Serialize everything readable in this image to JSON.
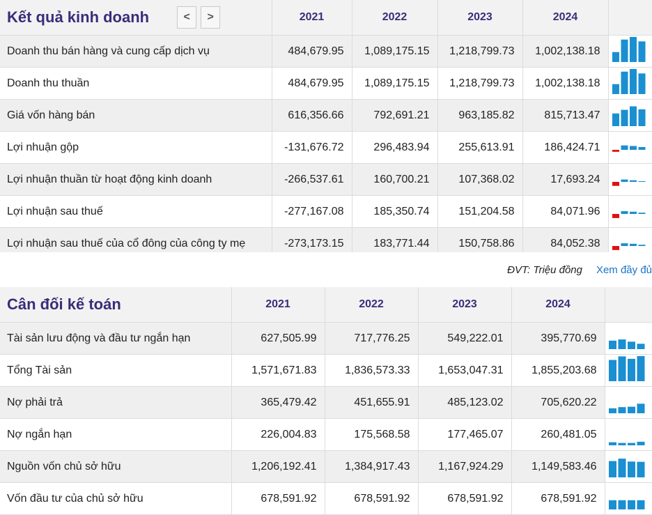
{
  "income": {
    "title": "Kết quả kinh doanh",
    "prev": "<",
    "next": ">",
    "years": [
      "2021",
      "2022",
      "2023",
      "2024"
    ],
    "rows": [
      {
        "label": "Doanh thu bán hàng và cung cấp dịch vụ",
        "values": [
          "484,679.95",
          "1,089,175.15",
          "1,218,799.73",
          "1,002,138.18"
        ],
        "v": [
          484679.95,
          1089175.15,
          1218799.73,
          1002138.18
        ]
      },
      {
        "label": "Doanh thu thuần",
        "values": [
          "484,679.95",
          "1,089,175.15",
          "1,218,799.73",
          "1,002,138.18"
        ],
        "v": [
          484679.95,
          1089175.15,
          1218799.73,
          1002138.18
        ]
      },
      {
        "label": "Giá vốn hàng bán",
        "values": [
          "616,356.66",
          "792,691.21",
          "963,185.82",
          "815,713.47"
        ],
        "v": [
          616356.66,
          792691.21,
          963185.82,
          815713.47
        ]
      },
      {
        "label": "Lợi nhuận gộp",
        "values": [
          "-131,676.72",
          "296,483.94",
          "255,613.91",
          "186,424.71"
        ],
        "v": [
          -131676.72,
          296483.94,
          255613.91,
          186424.71
        ]
      },
      {
        "label": "Lợi nhuận thuần từ hoạt động kinh doanh",
        "values": [
          "-266,537.61",
          "160,700.21",
          "107,368.02",
          "17,693.24"
        ],
        "v": [
          -266537.61,
          160700.21,
          107368.02,
          17693.24
        ]
      },
      {
        "label": "Lợi nhuận sau thuế",
        "values": [
          "-277,167.08",
          "185,350.74",
          "151,204.58",
          "84,071.96"
        ],
        "v": [
          -277167.08,
          185350.74,
          151204.58,
          84071.96
        ]
      },
      {
        "label": "Lợi nhuận sau thuế của cổ đông của công ty mẹ",
        "values": [
          "-273,173.15",
          "183,771.44",
          "150,758.86",
          "84,052.38"
        ],
        "v": [
          -273173.15,
          183771.44,
          150758.86,
          84052.38
        ]
      }
    ]
  },
  "footer": {
    "unit": "ĐVT: Triệu đồng",
    "more_link": "Xem đầy đủ"
  },
  "balance": {
    "title": "Cân đối kế toán",
    "years": [
      "2021",
      "2022",
      "2023",
      "2024"
    ],
    "rows": [
      {
        "label": "Tài sản lưu động và đầu tư ngắn hạn",
        "values": [
          "627,505.99",
          "717,776.25",
          "549,222.01",
          "395,770.69"
        ],
        "v": [
          627505.99,
          717776.25,
          549222.01,
          395770.69
        ]
      },
      {
        "label": "Tổng Tài sản",
        "values": [
          "1,571,671.83",
          "1,836,573.33",
          "1,653,047.31",
          "1,855,203.68"
        ],
        "v": [
          1571671.83,
          1836573.33,
          1653047.31,
          1855203.68
        ]
      },
      {
        "label": "Nợ phải trả",
        "values": [
          "365,479.42",
          "451,655.91",
          "485,123.02",
          "705,620.22"
        ],
        "v": [
          365479.42,
          451655.91,
          485123.02,
          705620.22
        ]
      },
      {
        "label": "Nợ ngắn hạn",
        "values": [
          "226,004.83",
          "175,568.58",
          "177,465.07",
          "260,481.05"
        ],
        "v": [
          226004.83,
          175568.58,
          177465.07,
          260481.05
        ]
      },
      {
        "label": "Nguồn vốn chủ sở hữu",
        "values": [
          "1,206,192.41",
          "1,384,917.43",
          "1,167,924.29",
          "1,149,583.46"
        ],
        "v": [
          1206192.41,
          1384917.43,
          1167924.29,
          1149583.46
        ]
      },
      {
        "label": "Vốn đầu tư của chủ sở hữu",
        "values": [
          "678,591.92",
          "678,591.92",
          "678,591.92",
          "678,591.92"
        ],
        "v": [
          678591.92,
          678591.92,
          678591.92,
          678591.92
        ]
      }
    ]
  },
  "colors": {
    "positive_bar": "#1a8fd1",
    "negative_bar": "#e01010",
    "header_text": "#3b2c7a",
    "link": "#1a73c9"
  }
}
